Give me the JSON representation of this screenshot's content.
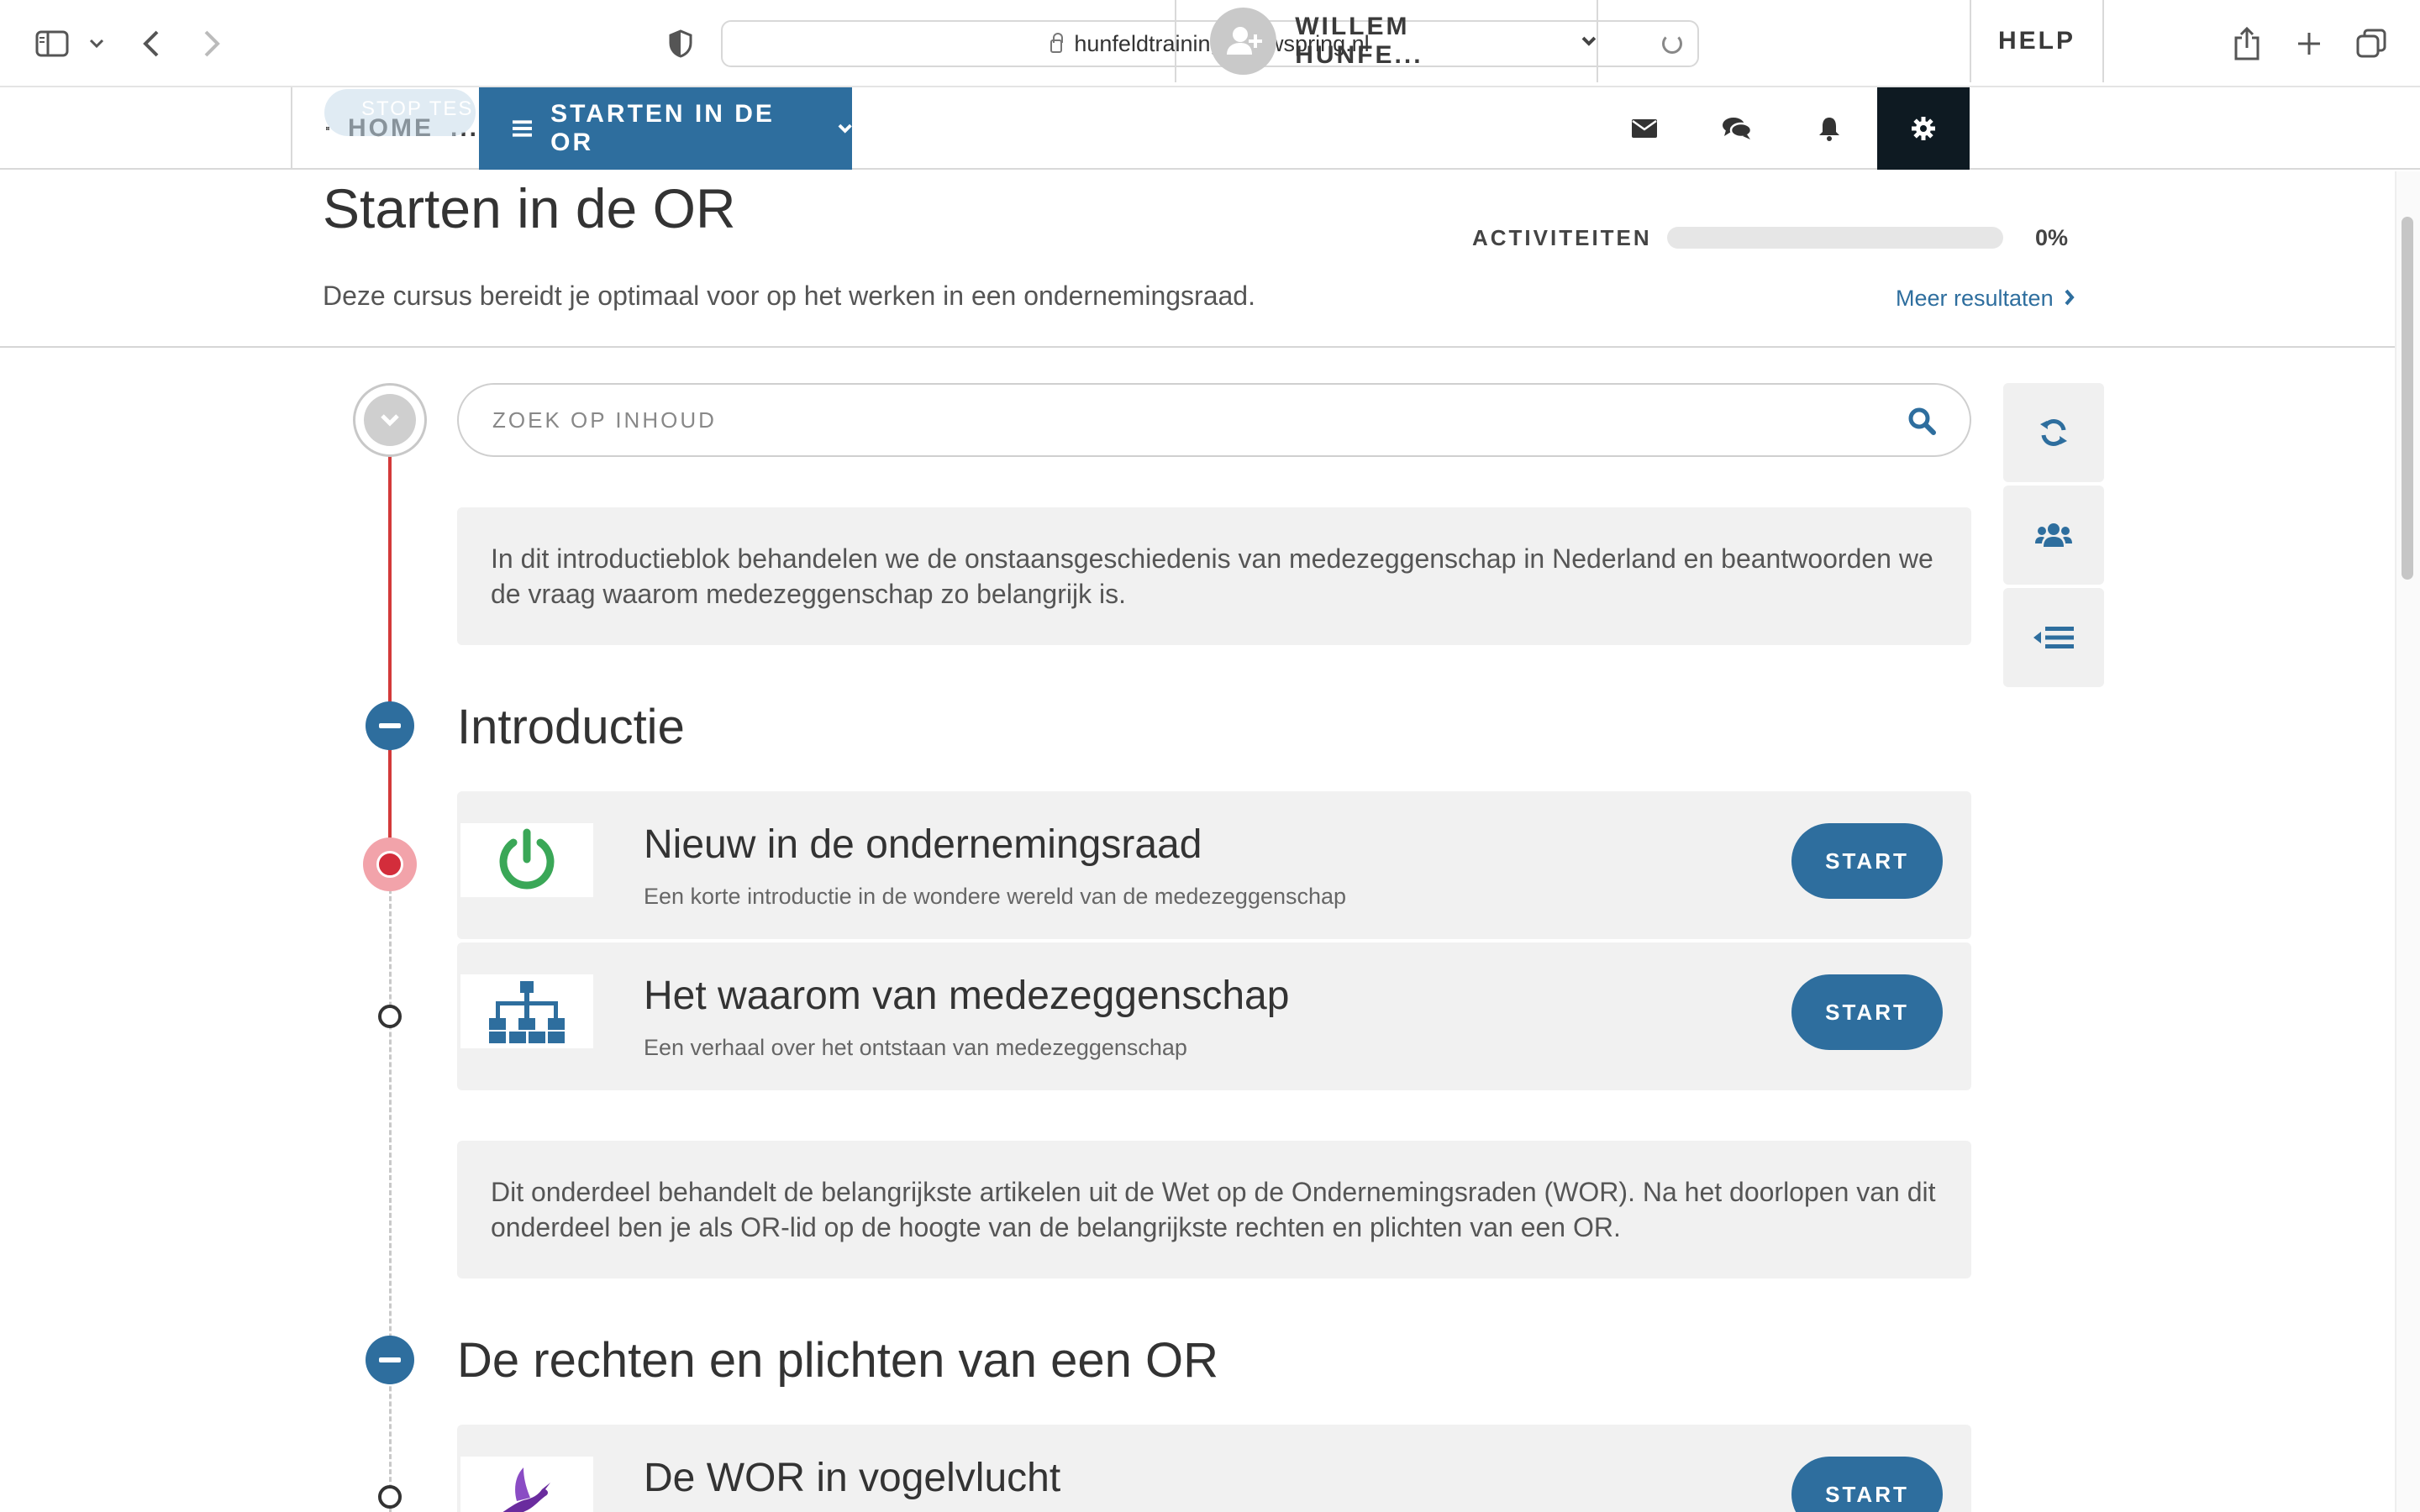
{
  "browser": {
    "url": "hunfeldtraining.anewspring.nl",
    "icons": [
      "sidebar-icon",
      "chevron-down-icon",
      "back-icon",
      "forward-icon",
      "shield-icon",
      "lock-icon",
      "reload-icon",
      "share-icon",
      "new-tab-icon",
      "tabs-overview-icon"
    ]
  },
  "nav": {
    "home_label": "HOME",
    "home_ellipsis": "...",
    "stop_ghost": "STOP TES",
    "course_label": "STARTEN IN DE OR",
    "user_name": "WILLEM HUNFE...",
    "help_label": "HELP",
    "icons": [
      "grid-icon",
      "hamburger-icon",
      "chevron-down-icon",
      "add-user-icon",
      "mail-icon",
      "chat-icon",
      "bell-icon",
      "gear-icon"
    ]
  },
  "header": {
    "title": "Starten in de OR",
    "description": "Deze cursus bereidt je optimaal voor op het werken in een ondernemingsraad.",
    "activities_label": "ACTIVITEITEN",
    "progress_value": "0%",
    "progress_fraction": 0,
    "more_results": "Meer resultaten"
  },
  "search": {
    "placeholder": "ZOEK OP INHOUD"
  },
  "tools": [
    "sync-icon",
    "users-icon",
    "outline-icon"
  ],
  "content": {
    "intro_text": "In dit introductieblok behandelen we de onstaansgeschiedenis van medezeggenschap in Nederland en beantwoorden we de vraag waarom medezeggenschap zo belangrijk is.",
    "section1": {
      "title": "Introductie",
      "items": [
        {
          "title": "Nieuw in de ondernemingsraad",
          "subtitle": "Een korte introductie in de wondere wereld van de medezeggenschap",
          "button": "START",
          "icon": "power-icon"
        },
        {
          "title": "Het waarom van medezeggenschap",
          "subtitle": "Een verhaal over het ontstaan van medezeggenschap",
          "button": "START",
          "icon": "org-chart-icon"
        }
      ]
    },
    "section2_intro": "Dit onderdeel behandelt de belangrijkste artikelen uit de Wet op de Ondernemingsraden (WOR). Na het doorlopen van dit onderdeel ben je als OR-lid op de hoogte van de belangrijkste rechten en plichten van een OR.",
    "section2": {
      "title": "De rechten en plichten van een OR",
      "items": [
        {
          "title": "De WOR in vogelvlucht",
          "button": "START",
          "icon": "bird-icon"
        }
      ]
    }
  },
  "colors": {
    "primary": "#2e6e9e",
    "timeline_red": "#d33a3a",
    "dark_tile": "#0e1a22",
    "power_green": "#3aa757"
  }
}
